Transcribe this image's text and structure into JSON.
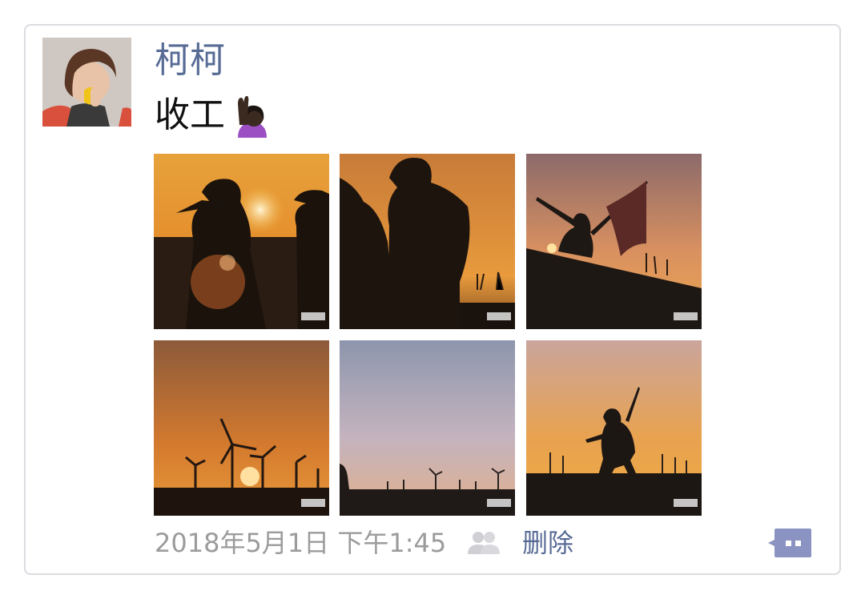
{
  "post": {
    "username": "柯柯",
    "text": "收工",
    "emoji": "raising-hand-emoji",
    "photos": [
      {
        "name": "photo-1",
        "subject": "hikers-silhouette-sunset"
      },
      {
        "name": "photo-2",
        "subject": "backpacker-silhouette"
      },
      {
        "name": "photo-3",
        "subject": "flag-bearer-on-hill"
      },
      {
        "name": "photo-4",
        "subject": "wind-turbines-sunset"
      },
      {
        "name": "photo-5",
        "subject": "twilight-wind-farm"
      },
      {
        "name": "photo-6",
        "subject": "walking-hiker-wind-farm"
      }
    ],
    "timestamp": "2018年5月1日 下午1:45",
    "delete_label": "删除"
  },
  "colors": {
    "name_link": "#576b95",
    "meta_text": "#9b9b9b",
    "comment_button": "#8a93c2"
  }
}
